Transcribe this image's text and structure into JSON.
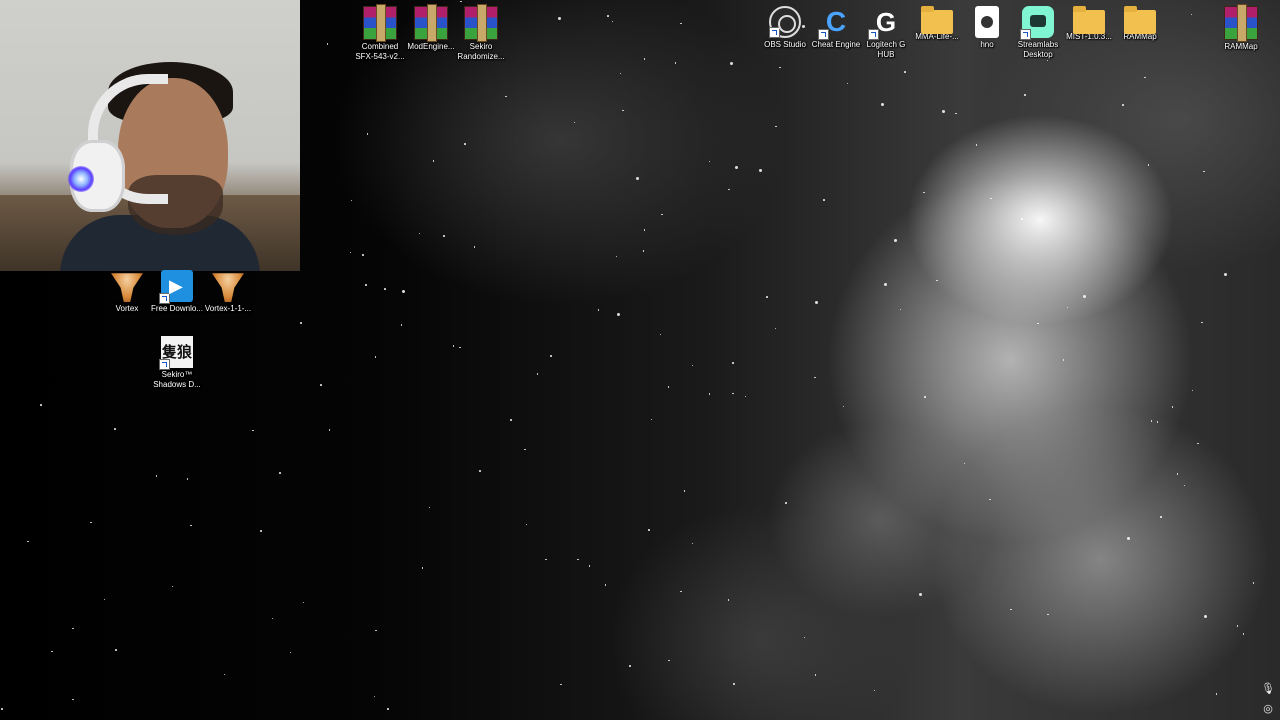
{
  "desktop": {
    "icons_top": [
      {
        "label": "Combined SFX-543-v2...",
        "icon": "winrar-archive-icon",
        "shortcut": false
      },
      {
        "label": "ModEngine...",
        "icon": "winrar-archive-icon",
        "shortcut": false
      },
      {
        "label": "Sekiro Randomize...",
        "icon": "winrar-archive-icon",
        "shortcut": false
      },
      {
        "label": "OBS Studio",
        "icon": "obs-studio-icon",
        "shortcut": true
      },
      {
        "label": "Cheat Engine",
        "icon": "cheat-engine-icon",
        "shortcut": true
      },
      {
        "label": "Logitech G HUB",
        "icon": "logitech-g-hub-icon",
        "shortcut": true
      },
      {
        "label": "MMA-Life-...",
        "icon": "folder-icon",
        "shortcut": false
      },
      {
        "label": "hno",
        "icon": "media-file-icon",
        "shortcut": false
      },
      {
        "label": "Streamlabs Desktop",
        "icon": "streamlabs-icon",
        "shortcut": true
      },
      {
        "label": "MIST-1.0.3...",
        "icon": "folder-icon",
        "shortcut": false
      },
      {
        "label": "RAMMap",
        "icon": "folder-icon",
        "shortcut": false
      },
      {
        "label": "RAMMap",
        "icon": "winrar-archive-icon",
        "shortcut": false
      }
    ],
    "icons_left": [
      {
        "label": "Vortex",
        "icon": "vortex-icon",
        "shortcut": true
      },
      {
        "label": "Free Downlo...",
        "icon": "free-download-manager-icon",
        "shortcut": true
      },
      {
        "label": "Vortex-1-1-...",
        "icon": "vortex-installer-icon",
        "shortcut": false
      },
      {
        "label": "Sekiro™ Shadows D...",
        "icon": "sekiro-icon",
        "shortcut": true
      }
    ]
  },
  "webcam": {
    "content": "webcam-overlay-person-with-headphones"
  },
  "tray": {
    "mic_icon": "microphone-icon",
    "settings_icon": "target-settings-icon"
  }
}
